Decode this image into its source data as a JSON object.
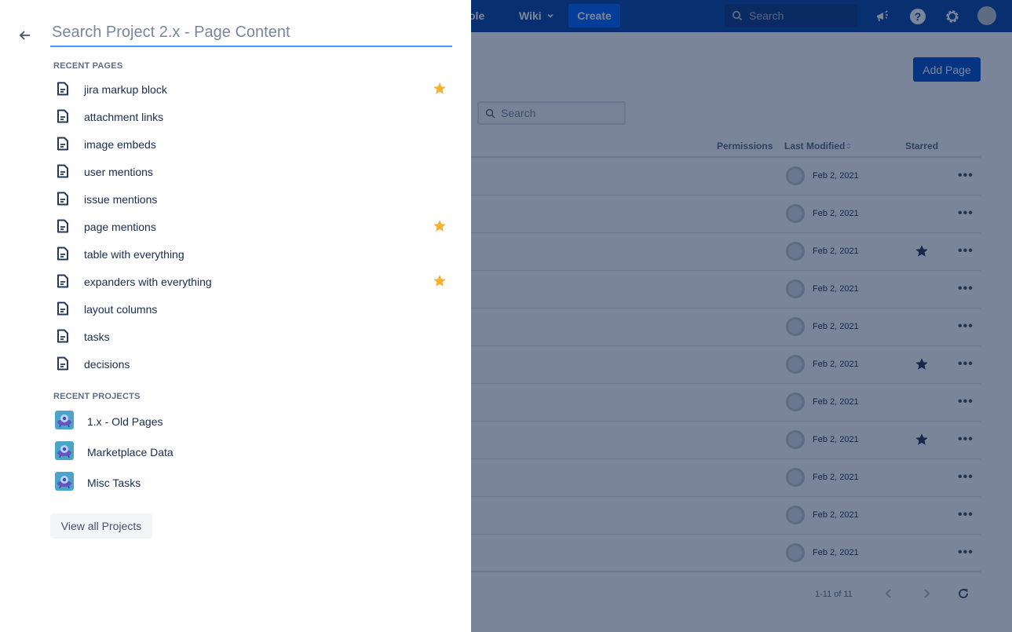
{
  "topnav": {
    "console_label": "Console",
    "wiki_label": "Wiki",
    "create_label": "Create",
    "search_placeholder": "Search"
  },
  "main": {
    "add_page_label": "Add Page",
    "search_placeholder": "Search",
    "columns": {
      "permissions": "Permissions",
      "last_modified": "Last Modified",
      "starred": "Starred"
    },
    "rows": [
      {
        "date": "Feb 2, 2021",
        "starred": false
      },
      {
        "date": "Feb 2, 2021",
        "starred": false
      },
      {
        "date": "Feb 2, 2021",
        "starred": true
      },
      {
        "date": "Feb 2, 2021",
        "starred": false
      },
      {
        "date": "Feb 2, 2021",
        "starred": false
      },
      {
        "date": "Feb 2, 2021",
        "starred": true
      },
      {
        "date": "Feb 2, 2021",
        "starred": false
      },
      {
        "date": "Feb 2, 2021",
        "starred": true
      },
      {
        "date": "Feb 2, 2021",
        "starred": false
      },
      {
        "date": "Feb 2, 2021",
        "starred": false
      },
      {
        "date": "Feb 2, 2021",
        "starred": false
      }
    ],
    "pagination": "1-11 of 11"
  },
  "drawer": {
    "search_placeholder": "Search Project 2.x - Page Content",
    "search_value": "",
    "recent_pages_heading": "RECENT PAGES",
    "recent_pages": [
      {
        "label": "jira markup block",
        "starred": true
      },
      {
        "label": "attachment links",
        "starred": false
      },
      {
        "label": "image embeds",
        "starred": false
      },
      {
        "label": "user mentions",
        "starred": false
      },
      {
        "label": "issue mentions",
        "starred": false
      },
      {
        "label": "page mentions",
        "starred": true
      },
      {
        "label": "table with everything",
        "starred": false
      },
      {
        "label": "expanders with everything",
        "starred": true
      },
      {
        "label": "layout columns",
        "starred": false
      },
      {
        "label": "tasks",
        "starred": false
      },
      {
        "label": "decisions",
        "starred": false
      }
    ],
    "recent_projects_heading": "RECENT PROJECTS",
    "recent_projects": [
      {
        "label": "1.x - Old Pages"
      },
      {
        "label": "Marketplace Data"
      },
      {
        "label": "Misc Tasks"
      }
    ],
    "view_all_label": "View all Projects"
  },
  "colors": {
    "nav_bg": "#0747a6",
    "primary": "#0052cc",
    "star_yellow": "#f6b12e",
    "star_dark": "#253858",
    "focus_border": "#4c9aff"
  }
}
